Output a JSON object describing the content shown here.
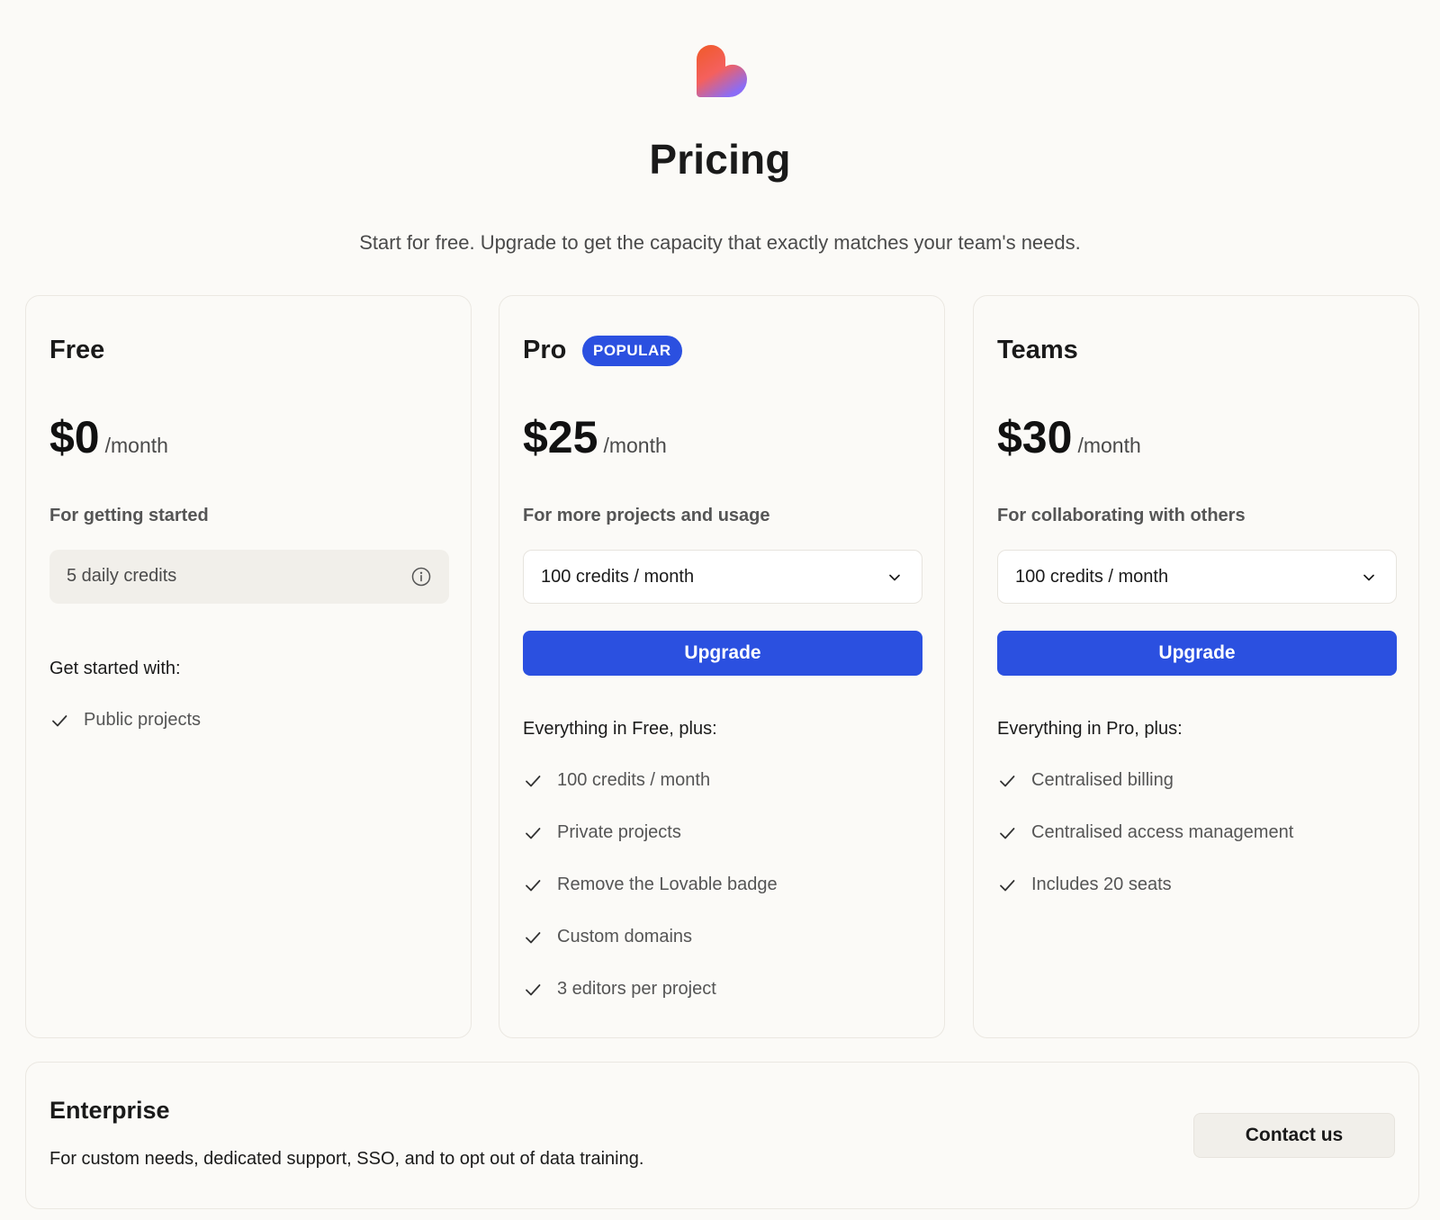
{
  "header": {
    "title": "Pricing",
    "subtitle": "Start for free. Upgrade to get the capacity that exactly matches your team's needs."
  },
  "plans": {
    "free": {
      "name": "Free",
      "price": "$0",
      "period": "/month",
      "tagline": "For getting started",
      "credits": "5 daily credits",
      "features_heading": "Get started with:",
      "features": [
        "Public projects"
      ]
    },
    "pro": {
      "name": "Pro",
      "badge": "POPULAR",
      "price": "$25",
      "period": "/month",
      "tagline": "For more projects and usage",
      "credits_select": "100 credits / month",
      "cta": "Upgrade",
      "features_heading": "Everything in Free, plus:",
      "features": [
        "100 credits / month",
        "Private projects",
        "Remove the Lovable badge",
        "Custom domains",
        "3 editors per project"
      ]
    },
    "teams": {
      "name": "Teams",
      "price": "$30",
      "period": "/month",
      "tagline": "For collaborating with others",
      "credits_select": "100 credits / month",
      "cta": "Upgrade",
      "features_heading": "Everything in Pro, plus:",
      "features": [
        "Centralised billing",
        "Centralised access management",
        "Includes 20 seats"
      ]
    }
  },
  "enterprise": {
    "title": "Enterprise",
    "description": "For custom needs, dedicated support, SSO, and to opt out of data training.",
    "cta": "Contact us"
  },
  "icons": {
    "logo": "heart-logo-icon",
    "check": "check-icon",
    "info": "info-icon",
    "chevron": "chevron-down-icon"
  },
  "colors": {
    "accent": "#2b50e0",
    "background": "#fbfaf7",
    "logo_gradient": [
      "#f05a28",
      "#f46a4e",
      "#8b6cf6"
    ]
  }
}
